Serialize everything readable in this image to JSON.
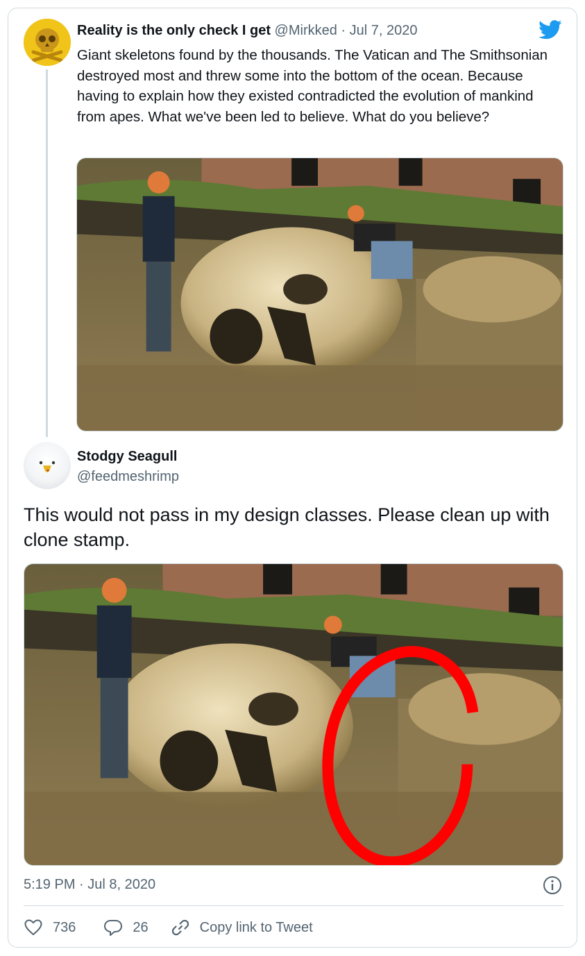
{
  "parent_tweet": {
    "author_name": "Reality is the only check I get",
    "handle": "@Mirkked",
    "separator": "·",
    "date": "Jul 7, 2020",
    "text": "Giant skeletons found by the thousands. The Vatican and The Smithsonian destroyed most and threw some into the bottom of the ocean. Because having to explain how they existed contradicted the evolution of mankind from apes. What we've been led to believe. What do you believe?",
    "avatar_icon": "skull-crossbones-icon"
  },
  "reply_tweet": {
    "author_name": "Stodgy Seagull",
    "handle": "@feedmeshrimp",
    "text": "This would not pass in my design classes. Please clean up with clone stamp.",
    "avatar_icon": "seagull-icon",
    "timestamp": "5:19 PM · Jul 8, 2020"
  },
  "actions": {
    "like_count": "736",
    "reply_count": "26",
    "copy_link_label": "Copy link to Tweet"
  },
  "colors": {
    "brand": "#1d9bf0",
    "muted": "#536471",
    "border": "#cfd9de",
    "highlight_circle": "#ff0000"
  },
  "icons": {
    "brand": "twitter-bird-icon",
    "info": "info-icon",
    "like": "heart-icon",
    "reply": "speech-bubble-icon",
    "link": "link-icon"
  }
}
